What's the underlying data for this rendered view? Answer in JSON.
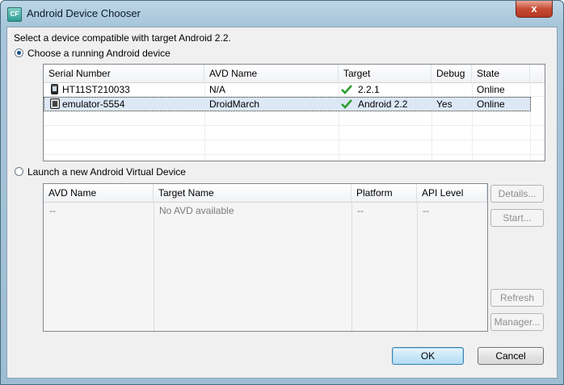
{
  "window": {
    "title": "Android Device Chooser",
    "app_icon": "CF",
    "close_symbol": "x"
  },
  "intro": "Select a device compatible with target Android 2.2.",
  "running": {
    "radio_label": "Choose a running Android device",
    "selected": true,
    "columns": [
      "Serial Number",
      "AVD Name",
      "Target",
      "Debug",
      "State"
    ],
    "rows": [
      {
        "serial": "HT11ST210033",
        "avd": "N/A",
        "target": "2.2.1",
        "debug": "",
        "state": "Online",
        "icon": "phone-icon"
      },
      {
        "serial": "emulator-5554",
        "avd": "DroidMarch",
        "target": "Android 2.2",
        "debug": "Yes",
        "state": "Online",
        "icon": "emulator-icon",
        "selected": true
      }
    ]
  },
  "launch": {
    "radio_label": "Launch a new Android Virtual Device",
    "selected": false,
    "columns": [
      "AVD Name",
      "Target Name",
      "Platform",
      "API Level"
    ],
    "rows": [
      {
        "avd": "--",
        "target": "No AVD available",
        "platform": "--",
        "api": "--"
      }
    ],
    "buttons": {
      "details": "Details...",
      "start": "Start...",
      "refresh": "Refresh",
      "manager": "Manager..."
    }
  },
  "footer": {
    "ok": "OK",
    "cancel": "Cancel"
  },
  "colors": {
    "selection": "#dde8f6",
    "check": "#2e9e2e",
    "title_bar": "#a8c6da"
  }
}
